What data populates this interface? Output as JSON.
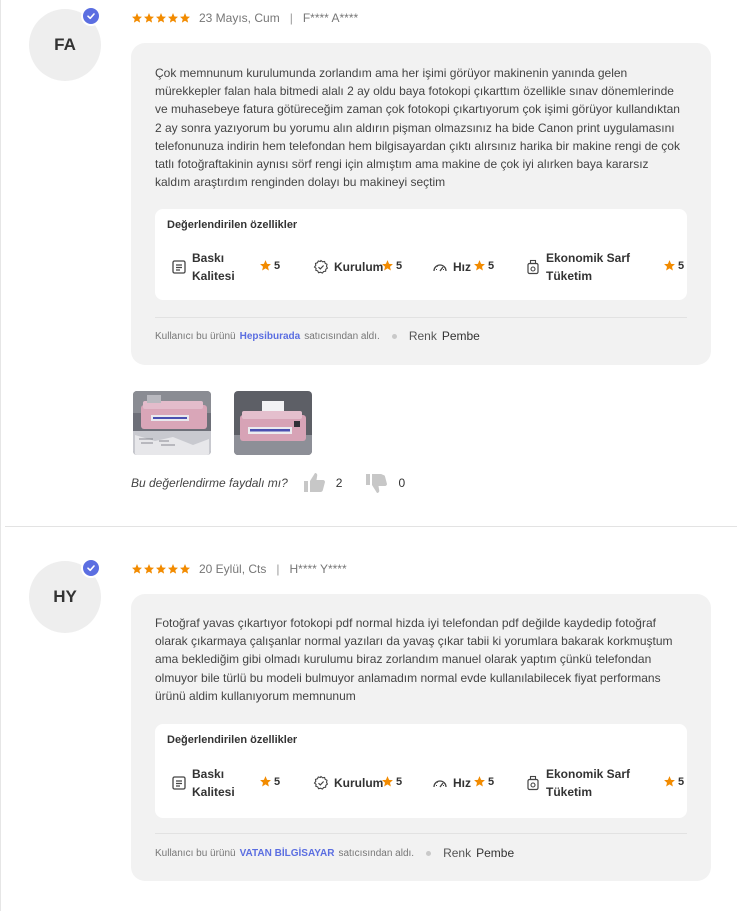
{
  "reviews": [
    {
      "initials": "FA",
      "rating": 5,
      "date": "23 Mayıs, Cum",
      "separator": "|",
      "user": "F**** A****",
      "comment": "Çok memnunum kurulumunda zorlandım ama her işimi görüyor makinenin yanında gelen mürekkepler falan hala bitmedi alalı 2 ay oldu baya fotokopi çıkarttım özellikle sınav dönemlerinde ve muhasebeye fatura götüreceğim zaman çok fotokopi çıkartıyorum çok işimi görüyor kullandıktan 2 ay sonra yazıyorum bu yorumu alın aldırın pişman olmazsınız ha bide Canon print uygulamasını telefonunuza indirin hem telefondan hem bilgisayardan çıktı alırsınız harika bir makine rengi de çok tatlı fotoğraftakinin aynısı sörf rengi için almıştım ama makine de çok iyi alırken baya kararsız kaldım araştırdım renginden dolayı bu makineyi seçtim",
      "features_title": "Değerlendirilen özellikler",
      "features": [
        {
          "label": "Baskı Kalitesi",
          "score": "5",
          "icon": "print-quality-icon"
        },
        {
          "label": "Kurulum",
          "score": "5",
          "icon": "setup-badge-icon"
        },
        {
          "label": "Hız",
          "score": "5",
          "icon": "speedometer-icon"
        },
        {
          "label": "Ekonomik Sarf Tüketim",
          "score": "5",
          "icon": "ink-bottle-icon"
        }
      ],
      "seller_prefix": "Kullanıcı bu ürünü",
      "seller_name": "Hepsiburada",
      "seller_suffix": "satıcısından aldı.",
      "color_label": "Renk",
      "color_value": "Pembe",
      "photos": [
        "printer-photo-1",
        "printer-photo-2"
      ],
      "helpful_question": "Bu değerlendirme faydalı mı?",
      "likes": "2",
      "dislikes": "0"
    },
    {
      "initials": "HY",
      "rating": 5,
      "date": "20 Eylül, Cts",
      "separator": "|",
      "user": "H**** Y****",
      "comment": "Fotoğraf yavas çıkartıyor fotokopi pdf normal hizda iyi telefondan pdf değilde kaydedip fotoğraf olarak çıkarmaya çalışanlar normal yazıları da yavaş çıkar tabii ki yorumlara bakarak korkmuştum ama beklediğim gibi olmadı kurulumu biraz zorlandım manuel olarak yaptım çünkü telefondan olmuyor bile türlü bu modeli bulmuyor anlamadım normal evde kullanılabilecek fiyat performans ürünü aldim kullanıyorum memnunum",
      "features_title": "Değerlendirilen özellikler",
      "features": [
        {
          "label": "Baskı Kalitesi",
          "score": "5",
          "icon": "print-quality-icon"
        },
        {
          "label": "Kurulum",
          "score": "5",
          "icon": "setup-badge-icon"
        },
        {
          "label": "Hız",
          "score": "5",
          "icon": "speedometer-icon"
        },
        {
          "label": "Ekonomik Sarf Tüketim",
          "score": "5",
          "icon": "ink-bottle-icon"
        }
      ],
      "seller_prefix": "Kullanıcı bu ürünü",
      "seller_name": "VATAN BİLGİSAYAR",
      "seller_suffix": "satıcısından aldı.",
      "color_label": "Renk",
      "color_value": "Pembe"
    }
  ],
  "colors": {
    "star": "#f28b00",
    "accent": "#5b6ee1",
    "card_bg": "#f2f2f2",
    "icon_gray": "#c7c7c7"
  }
}
